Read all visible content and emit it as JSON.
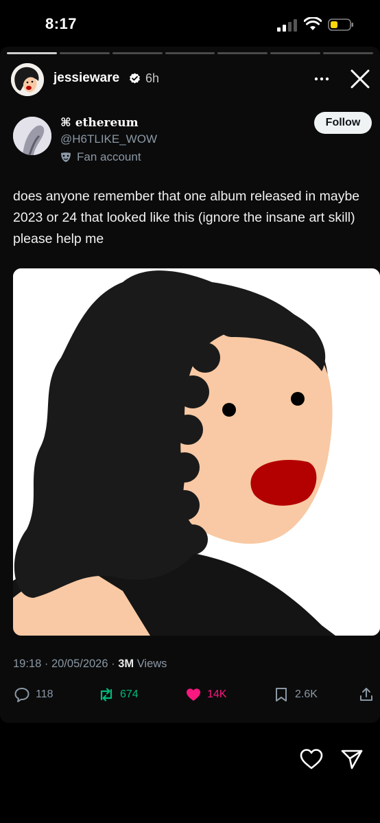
{
  "status_bar": {
    "time": "8:17"
  },
  "story": {
    "username": "jessieware",
    "time_ago": "6h",
    "progress_segments": 7,
    "active_segment": 1
  },
  "tweet": {
    "display_name": "⌘ ethereum",
    "handle": "@H6TLIKE_WOW",
    "label": "Fan account",
    "follow_label": "Follow",
    "text": "does anyone remember that one album released in maybe 2023 or 24 that looked like this (ignore the insane art skill) please help me",
    "timestamp": "19:18 · 20/05/2026 · ",
    "views_count": "3M",
    "views_label": " Views",
    "replies": "118",
    "reposts": "674",
    "likes": "14K",
    "bookmarks": "2.6K"
  },
  "colors": {
    "background": "#000000",
    "card": "#0b0b0b",
    "muted": "#8b98a5",
    "repost": "#00ba7c",
    "like": "#f91880",
    "lips": "#b30000",
    "skin": "#f8c9a4",
    "hair": "#1a1a1a"
  },
  "icons": [
    "signal-icon",
    "wifi-icon",
    "battery-icon",
    "verified-icon",
    "more-icon",
    "close-icon",
    "mask-icon",
    "reply-icon",
    "repost-icon",
    "like-icon",
    "bookmark-icon",
    "share-icon",
    "heart-icon",
    "send-icon"
  ]
}
